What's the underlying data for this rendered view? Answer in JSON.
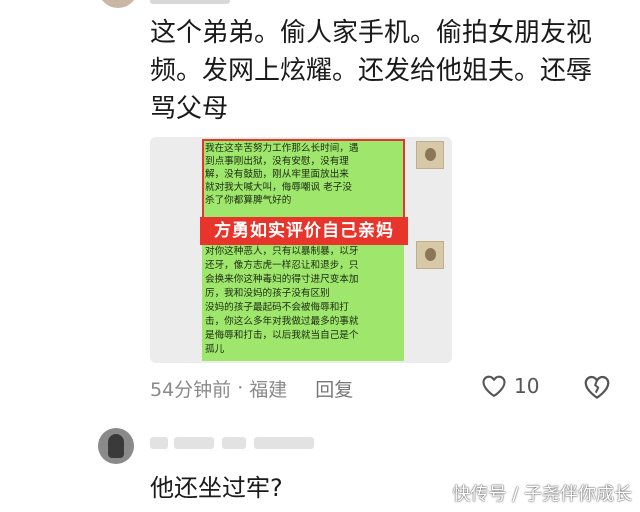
{
  "comment1": {
    "lines": [
      "这个弟弟。偷人家手机。偷拍女朋友视",
      "频。发网上炫耀。还发给他姐夫。还辱",
      "骂父母"
    ],
    "screenshot": {
      "banner": "方勇如实评价自己亲妈",
      "chat_lines": [
        "我在这辛苦努力工作那么长时间，遇",
        "到点事刚出狱，没有安慰，没有理",
        "解，没有鼓励，刚从牢里面放出来",
        "就对我大喊大叫，侮辱嘲讽 老子没",
        "杀了你都算脾气好的",
        "对你这种恶人，只有以暴制暴，以牙",
        "还牙，像方志虎一样忍让和退步，只",
        "会换来你这种毒妇的得寸进尺变本加",
        "厉，我和没妈的孩子没有区别",
        "没妈的孩子最起码不会被侮辱和打",
        "击，你这么多年对我做过最多的事就",
        "是侮辱和打击，以后我就当自己是个",
        "孤儿"
      ]
    },
    "meta": {
      "time": "54分钟前",
      "separator": "·",
      "location": "福建",
      "reply_label": "回复",
      "like_count": "10"
    }
  },
  "comment2": {
    "text": "他还坐过牢?"
  },
  "watermark": "快传号 / 子尧伴你成长",
  "icons": {
    "like": "heart-outline-icon",
    "dislike": "broken-heart-icon"
  },
  "colors": {
    "chat_bubble": "#9ee66c",
    "banner": "#e8352b",
    "meta_text": "#8a8a8a"
  }
}
